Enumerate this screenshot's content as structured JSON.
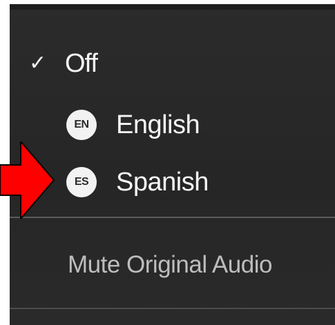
{
  "menu": {
    "items": [
      {
        "label": "Off",
        "checked": true,
        "check_glyph": "✓"
      },
      {
        "badge": "EN",
        "label": "English",
        "checked": false
      },
      {
        "badge": "ES",
        "label": "Spanish",
        "checked": false
      }
    ],
    "mute_label": "Mute Original Audio"
  },
  "annotation": {
    "arrow_color": "#ff0000",
    "arrow_icon": "red-arrow-icon"
  },
  "colors": {
    "menu_background": "#2a2a2a",
    "text": "#f4f4f4",
    "muted_text": "#bdbdbd",
    "badge_background": "#f2f2f2"
  }
}
